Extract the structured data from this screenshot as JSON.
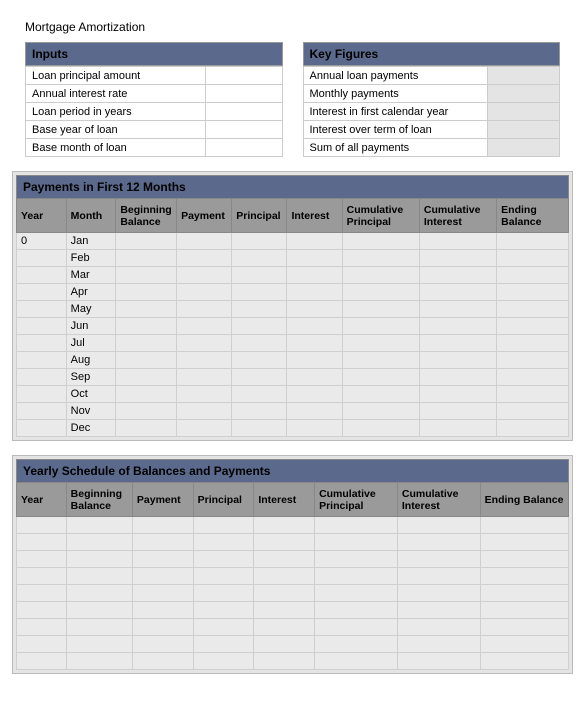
{
  "title": "Mortgage Amortization",
  "inputs": {
    "header": "Inputs",
    "rows": [
      {
        "label": "Loan principal amount",
        "value": ""
      },
      {
        "label": "Annual interest rate",
        "value": ""
      },
      {
        "label": "Loan period in years",
        "value": ""
      },
      {
        "label": "Base year of loan",
        "value": ""
      },
      {
        "label": "Base month of loan",
        "value": ""
      }
    ]
  },
  "key_figures": {
    "header": "Key Figures",
    "rows": [
      {
        "label": "Annual loan payments",
        "value": ""
      },
      {
        "label": "Monthly payments",
        "value": ""
      },
      {
        "label": "Interest in first calendar year",
        "value": ""
      },
      {
        "label": "Interest over term of loan",
        "value": ""
      },
      {
        "label": "Sum of all payments",
        "value": ""
      }
    ]
  },
  "monthly": {
    "header": "Payments in First 12 Months",
    "columns": [
      "Year",
      "Month",
      "Beginning Balance",
      "Payment",
      "Principal",
      "Interest",
      "Cumulative Principal",
      "Cumulative Interest",
      "Ending Balance"
    ],
    "rows": [
      {
        "year": "0",
        "month": "Jan"
      },
      {
        "year": "",
        "month": "Feb"
      },
      {
        "year": "",
        "month": "Mar"
      },
      {
        "year": "",
        "month": "Apr"
      },
      {
        "year": "",
        "month": "May"
      },
      {
        "year": "",
        "month": "Jun"
      },
      {
        "year": "",
        "month": "Jul"
      },
      {
        "year": "",
        "month": "Aug"
      },
      {
        "year": "",
        "month": "Sep"
      },
      {
        "year": "",
        "month": "Oct"
      },
      {
        "year": "",
        "month": "Nov"
      },
      {
        "year": "",
        "month": "Dec"
      }
    ]
  },
  "yearly": {
    "header": "Yearly Schedule of Balances and Payments",
    "columns": [
      "Year",
      "Beginning Balance",
      "Payment",
      "Principal",
      "Interest",
      "Cumulative Principal",
      "Cumulative Interest",
      "Ending Balance"
    ],
    "row_count": 9
  }
}
